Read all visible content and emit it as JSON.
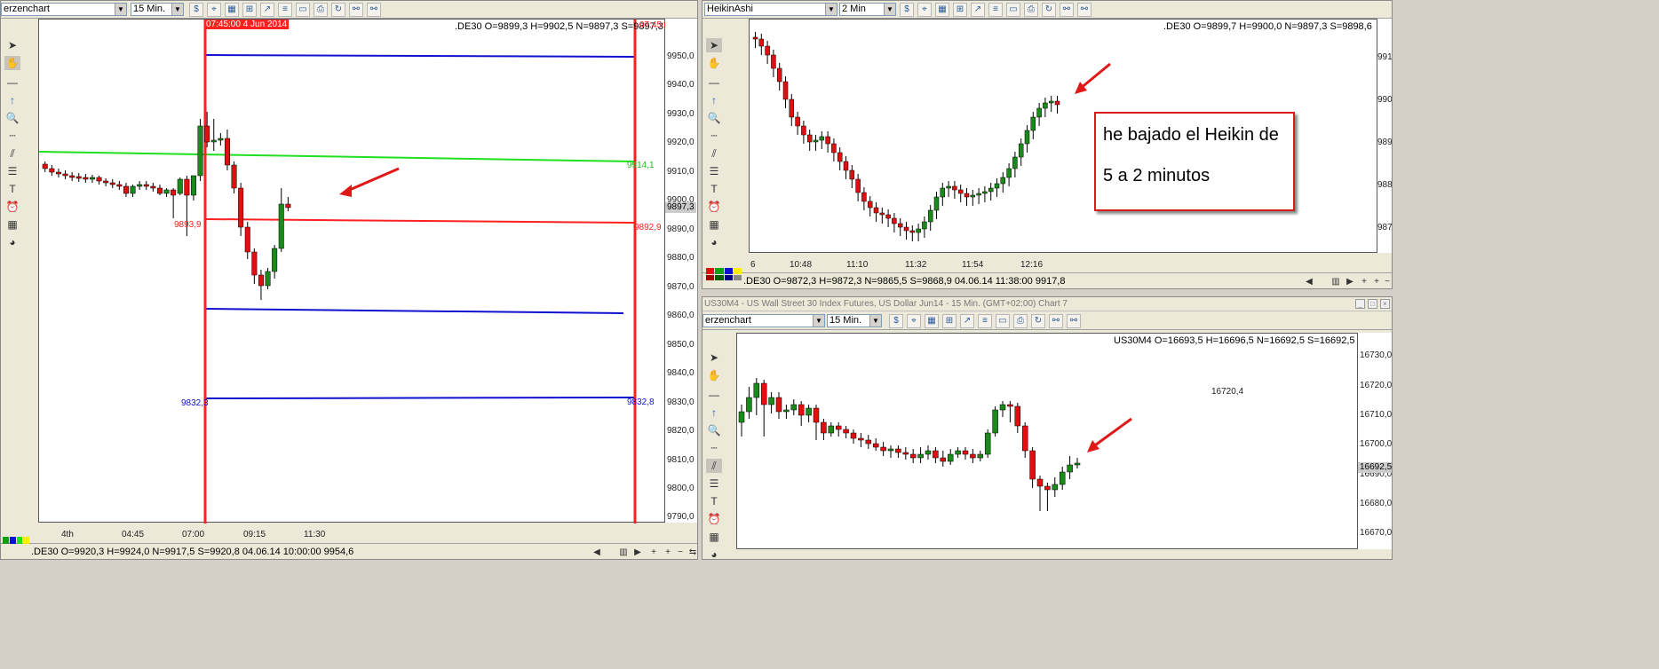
{
  "left_panel": {
    "chart_type_select": "erzenchart",
    "interval_select": "15 Min.",
    "ohlc_readout": ".DE30 O=9899,3 H=9902,5 N=9897,3 S=9897,3",
    "cursor_time_label": "07:45:00 4 Jun 2014",
    "right_line_time_fragment": "07:45:0",
    "price_axis": [
      "9950,0",
      "9940,0",
      "9930,0",
      "9920,0",
      "9910,0",
      "9900,0",
      "9890,0",
      "9880,0",
      "9870,0",
      "9860,0",
      "9850,0",
      "9840,0",
      "9830,0",
      "9820,0",
      "9810,0",
      "9800,0",
      "9790,0"
    ],
    "current_price_tag": "9897,3",
    "time_axis": [
      "4th",
      "04:45",
      "07:00",
      "09:15",
      "11:30"
    ],
    "annotations": {
      "green_line_right": "9914,1",
      "red_line_left": "9893,9",
      "red_line_right": "9892,9",
      "blue_line_left": "9832,3",
      "blue_line_right": "9832,8"
    },
    "status_text": ".DE30 O=9920,3 H=9924,0 N=9917,5 S=9920,8   04.06.14 10:00:00 9954,6"
  },
  "top_right_panel": {
    "chart_type_select": "HeikinAshi",
    "interval_select": "2 Min",
    "ohlc_readout": ".DE30 O=9899,7 H=9900,0 N=9897,3 S=9898,6",
    "price_axis_fragments": [
      "991",
      "990",
      "989",
      "988",
      "987"
    ],
    "time_axis": [
      "6",
      "10:48",
      "11:10",
      "11:32",
      "11:54",
      "12:16"
    ],
    "note_line1": "he bajado el Heikin de",
    "note_line2": "5 a 2 minutos",
    "status_text": ".DE30 O=9872,3 H=9872,3 N=9865,5 S=9868,9   04.06.14 11:38:00 9917,8"
  },
  "bottom_right_panel": {
    "window_title": "US30M4 - US Wall Street 30 Index Futures, US Dollar Jun14 - 15 Min. (GMT+02:00)   Chart 7",
    "chart_type_select": "erzenchart",
    "interval_select": "15 Min.",
    "ohlc_readout": "US30M4 O=16693,5 H=16696,5 N=16692,5 S=16692,5",
    "price_axis": [
      "16730,0",
      "16720,0",
      "16710,0",
      "16700,0",
      "16690,0",
      "16680,0",
      "16670,0"
    ],
    "current_price_tag": "16692,5",
    "overlay_value": "16720,4"
  },
  "colors": {
    "up_candle": "#1a8a1a",
    "down_candle": "#e01010",
    "red_line": "#ff2020",
    "blue_line": "#1010d0",
    "green_line": "#20e020",
    "arrow": "#e01818"
  }
}
